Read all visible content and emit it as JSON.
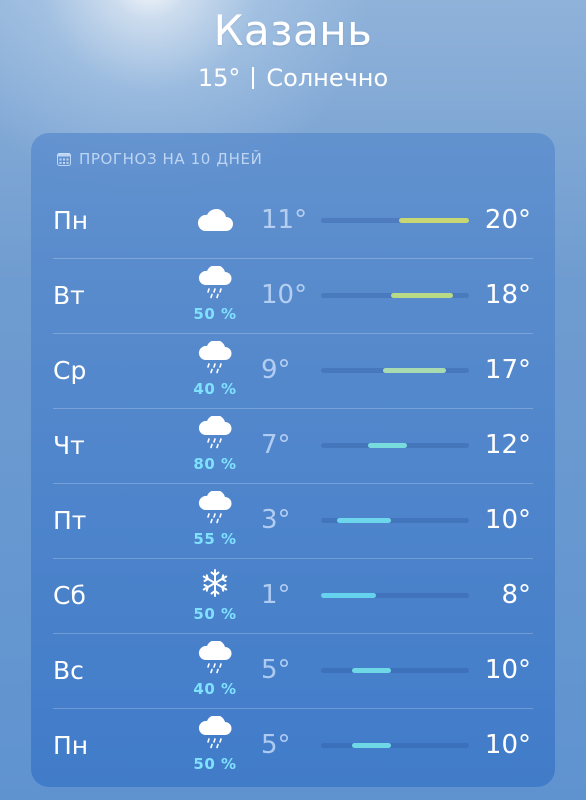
{
  "header": {
    "city": "Казань",
    "current_temp": "15°",
    "condition": "Солнечно"
  },
  "forecast": {
    "title": "ПРОГНОЗ НА 10 ДНЕЙ",
    "title_icon": "calendar-icon",
    "range_min": 1,
    "range_max": 20,
    "days": [
      {
        "day": "Пн",
        "icon": "cloud-icon",
        "prob": "",
        "lo": "11°",
        "hi": "20°",
        "lo_val": 11,
        "hi_val": 20,
        "color": "#c6d773"
      },
      {
        "day": "Вт",
        "icon": "rain-cloud-icon",
        "prob": "50 %",
        "lo": "10°",
        "hi": "18°",
        "lo_val": 10,
        "hi_val": 18,
        "color": "#b8da87"
      },
      {
        "day": "Ср",
        "icon": "rain-cloud-icon",
        "prob": "40 %",
        "lo": "9°",
        "hi": "17°",
        "lo_val": 9,
        "hi_val": 17,
        "color": "#a8dbb0"
      },
      {
        "day": "Чт",
        "icon": "rain-cloud-icon",
        "prob": "80 %",
        "lo": "7°",
        "hi": "12°",
        "lo_val": 7,
        "hi_val": 12,
        "color": "#79dcdc"
      },
      {
        "day": "Пт",
        "icon": "rain-cloud-icon",
        "prob": "55 %",
        "lo": "3°",
        "hi": "10°",
        "lo_val": 3,
        "hi_val": 10,
        "color": "#6dd6ea"
      },
      {
        "day": "Сб",
        "icon": "snowflake-icon",
        "prob": "50 %",
        "lo": "1°",
        "hi": "8°",
        "lo_val": 1,
        "hi_val": 8,
        "color": "#65d2ee"
      },
      {
        "day": "Вс",
        "icon": "rain-cloud-icon",
        "prob": "40 %",
        "lo": "5°",
        "hi": "10°",
        "lo_val": 5,
        "hi_val": 10,
        "color": "#6fd8e6"
      },
      {
        "day": "Пн",
        "icon": "rain-cloud-icon",
        "prob": "50 %",
        "lo": "5°",
        "hi": "10°",
        "lo_val": 5,
        "hi_val": 10,
        "color": "#6fd8e6"
      }
    ]
  }
}
